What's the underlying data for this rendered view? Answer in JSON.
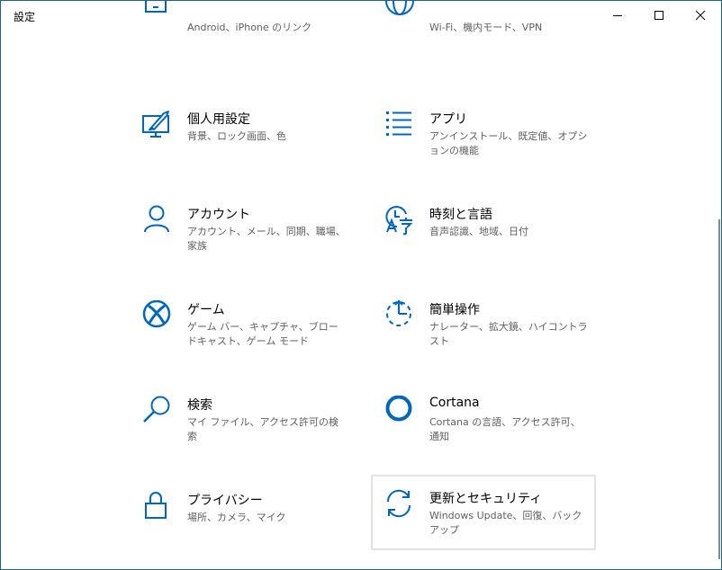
{
  "window": {
    "title": "設定"
  },
  "colors": {
    "accent": "#0067c0",
    "desc": "#5f5f5f",
    "hover_border": "#e3e3e3"
  },
  "tiles": [
    {
      "label": "",
      "desc": "Android、iPhone のリンク",
      "icon": "phone-icon"
    },
    {
      "label": "",
      "desc": "Wi-Fi、機内モード、VPN",
      "icon": "globe-icon"
    },
    {
      "label": "個人用設定",
      "desc": "背景、ロック画面、色",
      "icon": "personalization-icon"
    },
    {
      "label": "アプリ",
      "desc": "アンインストール、既定値、オプションの機能",
      "icon": "apps-list-icon"
    },
    {
      "label": "アカウント",
      "desc": "アカウント、メール、同期、職場、家族",
      "icon": "person-icon"
    },
    {
      "label": "時刻と言語",
      "desc": "音声認識、地域、日付",
      "icon": "time-language-icon"
    },
    {
      "label": "ゲーム",
      "desc": "ゲーム バー、キャプチャ、ブロードキャスト、ゲーム モード",
      "icon": "xbox-icon"
    },
    {
      "label": "簡単操作",
      "desc": "ナレーター、拡大鏡、ハイコントラスト",
      "icon": "ease-of-access-icon"
    },
    {
      "label": "検索",
      "desc": "マイ ファイル、アクセス許可の検索",
      "icon": "search-icon"
    },
    {
      "label": "Cortana",
      "desc": "Cortana の言語、アクセス許可、通知",
      "icon": "cortana-icon"
    },
    {
      "label": "プライバシー",
      "desc": "場所、カメラ、マイク",
      "icon": "lock-icon"
    },
    {
      "label": "更新とセキュリティ",
      "desc": "Windows Update、回復、バックアップ",
      "icon": "sync-icon"
    }
  ]
}
